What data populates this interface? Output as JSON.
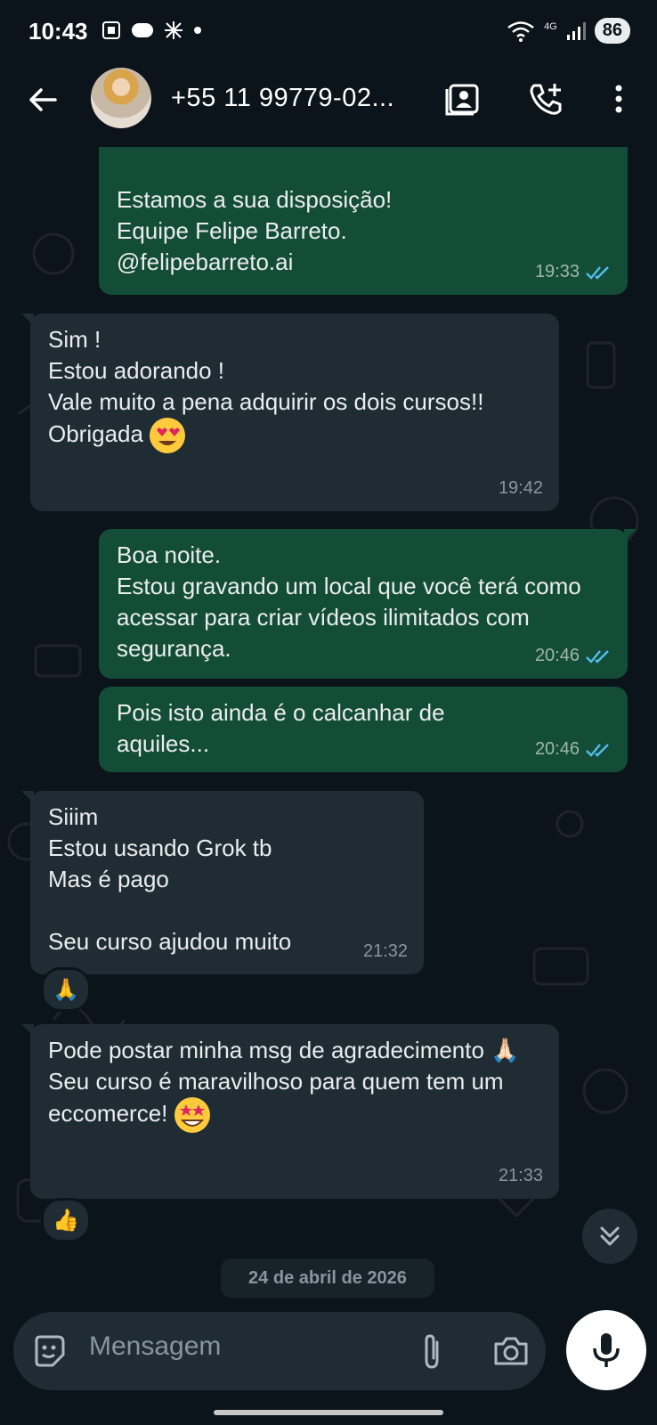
{
  "status_bar": {
    "time": "10:43",
    "network": "4G",
    "battery": "86"
  },
  "header": {
    "contact_name": "+55 11 99779-02..."
  },
  "messages": [
    {
      "id": "m1",
      "direction": "out",
      "text": "Estamos a sua disposição!\nEquipe Felipe Barreto.\n@felipebarreto.ai",
      "time": "19:33",
      "read": true
    },
    {
      "id": "m2",
      "direction": "in",
      "text": "Sim !\nEstou adorando !\nVale muito a pena adquirir os dois cursos!!\nObrigada",
      "emoji": "heart-eyes",
      "time": "19:42"
    },
    {
      "id": "m3",
      "direction": "out",
      "text": "Boa noite.\nEstou gravando um local que você terá como acessar para criar vídeos ilimitados com segurança.",
      "time": "20:46",
      "read": true
    },
    {
      "id": "m4",
      "direction": "out",
      "text": "Pois isto ainda é o calcanhar de aquiles...",
      "time": "20:46",
      "read": true
    },
    {
      "id": "m5",
      "direction": "in",
      "text": "Siiim\nEstou usando Grok tb\nMas é pago\n\nSeu curso ajudou muito",
      "time": "21:32",
      "reaction": "🙏"
    },
    {
      "id": "m6",
      "direction": "in",
      "text": "Pode postar minha msg de agradecimento 🙏🏻\nSeu curso é maravilhoso para quem tem um eccomerce!",
      "emoji": "star-struck",
      "time": "21:33",
      "reaction": "👍"
    }
  ],
  "date_separator": "24 de abril de 2026",
  "composer": {
    "placeholder": "Mensagem"
  },
  "colors": {
    "outgoing": "#144d37",
    "incoming": "#202c33",
    "background": "#0b141a",
    "read_ticks": "#53bdeb"
  }
}
